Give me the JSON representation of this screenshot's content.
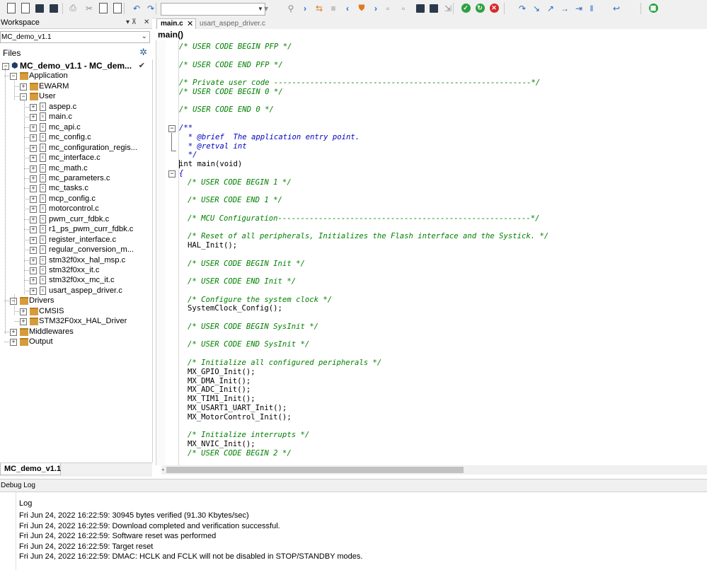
{
  "toolbar": {
    "search_value": "",
    "icons": [
      "new-file-icon",
      "open-file-icon",
      "save-icon",
      "save-all-icon",
      "print-icon",
      "cut-icon",
      "copy-icon",
      "paste-icon",
      "undo-icon",
      "redo-icon",
      "search-dropdown-icon",
      "find-icon",
      "next-icon",
      "replace-icon",
      "find-in-files-icon",
      "back-icon",
      "bookmark-icon",
      "forward-icon",
      "toggle-bookmark-icon",
      "next-bookmark-icon",
      "download-icon",
      "download-debug-icon",
      "build-icon",
      "go-icon",
      "reset-icon",
      "stop-icon",
      "step-over-icon",
      "step-into-icon",
      "step-out-icon",
      "next-statement-icon",
      "run-to-cursor-icon",
      "break-icon",
      "reset-debug-icon",
      "layout-icon"
    ]
  },
  "workspace": {
    "title": "Workspace",
    "pin": "▾ ⊼",
    "close": "✕",
    "selected_config": "MC_demo_v1.1",
    "files_label": "Files",
    "root": "MC_demo_v1.1 - MC_dem...",
    "tree": [
      {
        "label": "Application",
        "kind": "folder",
        "level": 1,
        "state": "-"
      },
      {
        "label": "EWARM",
        "kind": "folder",
        "level": 2,
        "state": "+"
      },
      {
        "label": "User",
        "kind": "folder",
        "level": 2,
        "state": "-"
      },
      {
        "label": "aspep.c",
        "kind": "file",
        "level": 3,
        "state": "+"
      },
      {
        "label": "main.c",
        "kind": "file",
        "level": 3,
        "state": "+"
      },
      {
        "label": "mc_api.c",
        "kind": "file",
        "level": 3,
        "state": "+"
      },
      {
        "label": "mc_config.c",
        "kind": "file",
        "level": 3,
        "state": "+"
      },
      {
        "label": "mc_configuration_regis...",
        "kind": "file",
        "level": 3,
        "state": "+"
      },
      {
        "label": "mc_interface.c",
        "kind": "file",
        "level": 3,
        "state": "+"
      },
      {
        "label": "mc_math.c",
        "kind": "file",
        "level": 3,
        "state": "+"
      },
      {
        "label": "mc_parameters.c",
        "kind": "file",
        "level": 3,
        "state": "+"
      },
      {
        "label": "mc_tasks.c",
        "kind": "file",
        "level": 3,
        "state": "+"
      },
      {
        "label": "mcp_config.c",
        "kind": "file",
        "level": 3,
        "state": "+"
      },
      {
        "label": "motorcontrol.c",
        "kind": "file",
        "level": 3,
        "state": "+"
      },
      {
        "label": "pwm_curr_fdbk.c",
        "kind": "file",
        "level": 3,
        "state": "+"
      },
      {
        "label": "r1_ps_pwm_curr_fdbk.c",
        "kind": "file",
        "level": 3,
        "state": "+"
      },
      {
        "label": "register_interface.c",
        "kind": "file",
        "level": 3,
        "state": "+"
      },
      {
        "label": "regular_conversion_m...",
        "kind": "file",
        "level": 3,
        "state": "+"
      },
      {
        "label": "stm32f0xx_hal_msp.c",
        "kind": "file",
        "level": 3,
        "state": "+"
      },
      {
        "label": "stm32f0xx_it.c",
        "kind": "file",
        "level": 3,
        "state": "+"
      },
      {
        "label": "stm32f0xx_mc_it.c",
        "kind": "file",
        "level": 3,
        "state": "+"
      },
      {
        "label": "usart_aspep_driver.c",
        "kind": "file",
        "level": 3,
        "state": "+"
      },
      {
        "label": "Drivers",
        "kind": "folder",
        "level": 1,
        "state": "-"
      },
      {
        "label": "CMSIS",
        "kind": "folder",
        "level": 2,
        "state": "+"
      },
      {
        "label": "STM32F0xx_HAL_Driver",
        "kind": "folder",
        "level": 2,
        "state": "+"
      },
      {
        "label": "Middlewares",
        "kind": "folder",
        "level": 1,
        "state": "+"
      },
      {
        "label": "Output",
        "kind": "folder",
        "level": 1,
        "state": "+"
      }
    ],
    "bottom_tab": "MC_demo_v1.1"
  },
  "editor": {
    "tabs": [
      {
        "label": "main.c",
        "close": "✕"
      },
      {
        "label": "usart_aspep_driver.c"
      }
    ],
    "function": "main()",
    "lines": [
      {
        "row": 0,
        "indent": 0,
        "cls": "cm",
        "text": "/* USER CODE BEGIN PFP */"
      },
      {
        "row": 2,
        "indent": 0,
        "cls": "cm",
        "text": "/* USER CODE END PFP */"
      },
      {
        "row": 4,
        "indent": 0,
        "cls": "cm",
        "text": "/* Private user code ---------------------------------------------------------*/"
      },
      {
        "row": 5,
        "indent": 0,
        "cls": "cm",
        "text": "/* USER CODE BEGIN 0 */"
      },
      {
        "row": 7,
        "indent": 0,
        "cls": "cm",
        "text": "/* USER CODE END 0 */"
      },
      {
        "row": 9,
        "indent": 0,
        "cls": "dc",
        "text": "/**"
      },
      {
        "row": 10,
        "indent": 0,
        "cls": "dc",
        "text": "  * @brief  The application entry point."
      },
      {
        "row": 11,
        "indent": 0,
        "cls": "dc",
        "text": "  * @retval int"
      },
      {
        "row": 12,
        "indent": 0,
        "cls": "dc",
        "text": "  */"
      },
      {
        "row": 13,
        "indent": 0,
        "cls": "kw",
        "text": "int main(void)"
      },
      {
        "row": 14,
        "indent": 0,
        "cls": "dc",
        "text": "{"
      },
      {
        "row": 15,
        "indent": 1,
        "cls": "cm",
        "text": "/* USER CODE BEGIN 1 */"
      },
      {
        "row": 17,
        "indent": 1,
        "cls": "cm",
        "text": "/* USER CODE END 1 */"
      },
      {
        "row": 19,
        "indent": 1,
        "cls": "cm",
        "text": "/* MCU Configuration--------------------------------------------------------*/"
      },
      {
        "row": 21,
        "indent": 1,
        "cls": "cm",
        "text": "/* Reset of all peripherals, Initializes the Flash interface and the Systick. */"
      },
      {
        "row": 22,
        "indent": 1,
        "cls": "kw",
        "text": "HAL_Init();"
      },
      {
        "row": 24,
        "indent": 1,
        "cls": "cm",
        "text": "/* USER CODE BEGIN Init */"
      },
      {
        "row": 26,
        "indent": 1,
        "cls": "cm",
        "text": "/* USER CODE END Init */"
      },
      {
        "row": 28,
        "indent": 1,
        "cls": "cm",
        "text": "/* Configure the system clock */"
      },
      {
        "row": 29,
        "indent": 1,
        "cls": "kw",
        "text": "SystemClock_Config();"
      },
      {
        "row": 31,
        "indent": 1,
        "cls": "cm",
        "text": "/* USER CODE BEGIN SysInit */"
      },
      {
        "row": 33,
        "indent": 1,
        "cls": "cm",
        "text": "/* USER CODE END SysInit */"
      },
      {
        "row": 35,
        "indent": 1,
        "cls": "cm",
        "text": "/* Initialize all configured peripherals */"
      },
      {
        "row": 36,
        "indent": 1,
        "cls": "kw",
        "text": "MX_GPIO_Init();"
      },
      {
        "row": 37,
        "indent": 1,
        "cls": "kw",
        "text": "MX_DMA_Init();"
      },
      {
        "row": 38,
        "indent": 1,
        "cls": "kw",
        "text": "MX_ADC_Init();"
      },
      {
        "row": 39,
        "indent": 1,
        "cls": "kw",
        "text": "MX_TIM1_Init();"
      },
      {
        "row": 40,
        "indent": 1,
        "cls": "kw",
        "text": "MX_USART1_UART_Init();"
      },
      {
        "row": 41,
        "indent": 1,
        "cls": "kw",
        "text": "MX_MotorControl_Init();"
      },
      {
        "row": 43,
        "indent": 1,
        "cls": "cm",
        "text": "/* Initialize interrupts */"
      },
      {
        "row": 44,
        "indent": 1,
        "cls": "kw",
        "text": "MX_NVIC_Init();"
      },
      {
        "row": 45,
        "indent": 1,
        "cls": "cm",
        "text": "/* USER CODE BEGIN 2 */"
      }
    ]
  },
  "debug_log": {
    "title": "Debug Log",
    "header": "Log",
    "entries": [
      "Fri Jun 24, 2022 16:22:59: 30945 bytes verified (91.30 Kbytes/sec)",
      "Fri Jun 24, 2022 16:22:59: Download completed and verification successful.",
      "Fri Jun 24, 2022 16:22:59: Software reset was performed",
      "Fri Jun 24, 2022 16:22:59: Target reset",
      "Fri Jun 24, 2022 16:22:59: DMAC: HCLK and FCLK will not be disabled in STOP/STANDBY modes."
    ]
  }
}
